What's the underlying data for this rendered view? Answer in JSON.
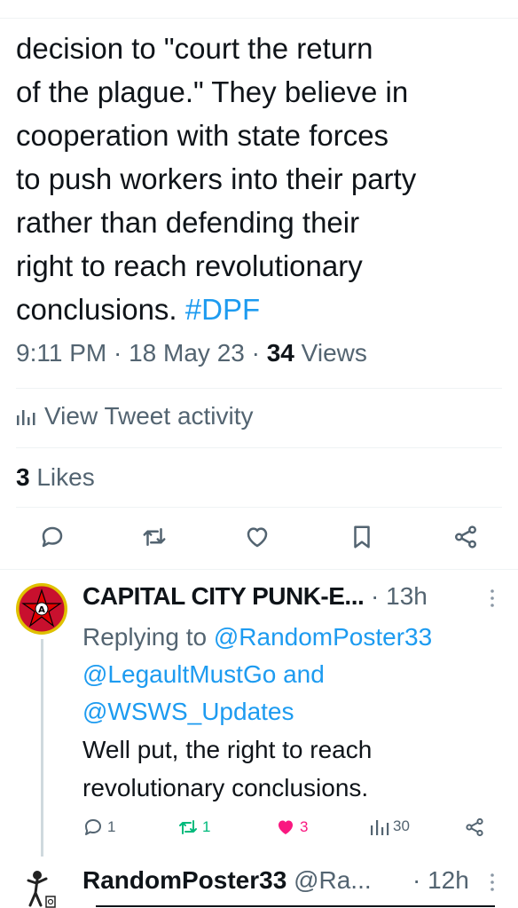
{
  "tweet": {
    "text_lines": [
      "decision to \"court the return",
      "of the plague.\" They believe in",
      "cooperation with state forces",
      "to push workers into their party",
      "rather than defending their",
      "right to reach revolutionary",
      "conclusions."
    ],
    "hashtag": "#DPF",
    "time": "9:11 PM",
    "date": "18 May 23",
    "views_count": "34",
    "views_label": "Views",
    "activity_label": "View Tweet activity",
    "likes_count": "3",
    "likes_label": "Likes",
    "action_icons": [
      "reply-icon",
      "retweet-icon",
      "like-icon",
      "bookmark-icon",
      "share-icon"
    ]
  },
  "reply1": {
    "name": "CAPITAL CITY PUNK-E...",
    "time": "13h",
    "replying_prefix": "Replying to",
    "mentions": [
      "@RandomPoster33",
      "@LegaultMustGo",
      "@WSWS_Updates"
    ],
    "and_word": "and",
    "text_lines": [
      "Well put, the right to reach",
      "revolutionary conclusions."
    ],
    "replies": "1",
    "retweets": "1",
    "likes": "3",
    "views": "30",
    "colors": {
      "retweet": "#00ba7c",
      "like": "#f91880",
      "mention": "#1d9bf0"
    }
  },
  "reply2": {
    "name": "RandomPoster33",
    "handle": "@Ra...",
    "time": "12h"
  }
}
